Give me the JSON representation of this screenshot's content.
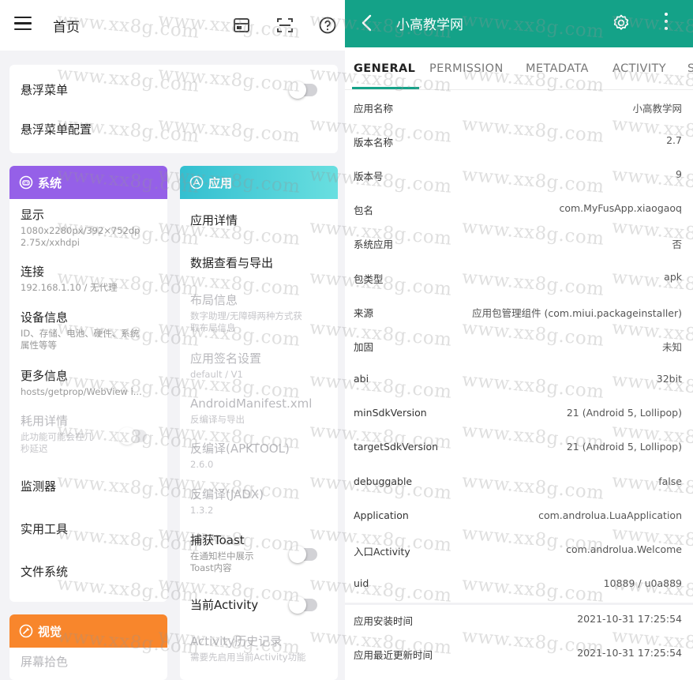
{
  "left": {
    "topbar": {
      "title": "首页",
      "icons": [
        "menu-icon",
        "window-icon",
        "scan-icon",
        "help-icon"
      ]
    },
    "float_card": {
      "items": [
        "悬浮菜单",
        "悬浮菜单配置"
      ]
    },
    "system": {
      "header": "系统",
      "color": "#9560e8",
      "items": [
        {
          "title": "显示",
          "sub": "1080x2280px/392×752dp\n2.75x/xxhdpi"
        },
        {
          "title": "连接",
          "sub": "192.168.1.10 / 无代理"
        },
        {
          "title": "设备信息",
          "sub": "ID、存储、电池、硬件、系统\n属性等等"
        },
        {
          "title": "更多信息",
          "sub": "hosts/getprop/WebView i..."
        },
        {
          "title": "耗用详情",
          "sub": "此功能可能会在几\n秒延迟"
        },
        {
          "title": "监测器",
          "sub": ""
        },
        {
          "title": "实用工具",
          "sub": ""
        },
        {
          "title": "文件系统",
          "sub": ""
        }
      ]
    },
    "apps": {
      "header": "应用",
      "color": "#3fc6cf",
      "items": [
        {
          "title": "应用详情",
          "sub": ""
        },
        {
          "title": "数据查看与导出",
          "sub": ""
        },
        {
          "title": "布局信息",
          "sub": "数字助理/无障碍两种方式获\n取布局信息"
        },
        {
          "title": "应用签名设置",
          "sub": "default / V1"
        },
        {
          "title": "AndroidManifest.xml",
          "sub": "反编译与导出"
        },
        {
          "title": "反编译(APKTOOL)",
          "sub": "2.6.0"
        },
        {
          "title": "反编译(JADX)",
          "sub": "1.3.2"
        },
        {
          "title": "捕获Toast",
          "sub": "在通知栏中展示\nToast内容"
        },
        {
          "title": "当前Activity",
          "sub": ""
        },
        {
          "title": "Activity历史记录",
          "sub": "需要先启用当前Activity功能"
        }
      ]
    },
    "vision": {
      "header": "视觉",
      "color": "#f8862c",
      "items": [
        {
          "title": "屏幕拾色"
        }
      ]
    }
  },
  "right": {
    "appbar": {
      "title": "小高教学网"
    },
    "tabs": [
      "GENERAL",
      "PERMISSION",
      "METADATA",
      "ACTIVITY",
      "S"
    ],
    "active_tab": "GENERAL",
    "rows": [
      {
        "key": "应用名称",
        "value": "小高教学网"
      },
      {
        "key": "版本名称",
        "value": "2.7"
      },
      {
        "key": "版本号",
        "value": "9"
      },
      {
        "key": "包名",
        "value": "com.MyFusApp.xiaogaoq"
      },
      {
        "key": "系统应用",
        "value": "否"
      },
      {
        "key": "包类型",
        "value": "apk"
      },
      {
        "key": "来源",
        "value": "应用包管理组件 (com.miui.packageinstaller)"
      },
      {
        "key": "加固",
        "value": "未知"
      },
      {
        "key": "abi",
        "value": "32bit"
      },
      {
        "key": "minSdkVersion",
        "value": "21 (Android 5, Lollipop)"
      },
      {
        "key": "targetSdkVersion",
        "value": "21 (Android 5, Lollipop)"
      },
      {
        "key": "debuggable",
        "value": "false"
      },
      {
        "key": "Application",
        "value": "com.androlua.LuaApplication"
      },
      {
        "key": "入口Activity",
        "value": "com.androlua.Welcome"
      },
      {
        "key": "uid",
        "value": "10889 / u0a889"
      },
      {
        "key": "应用安装时间",
        "value": "2021-10-31 17:25:54"
      },
      {
        "key": "应用最近更新时间",
        "value": "2021-10-31 17:25:54"
      }
    ],
    "accent": "#14a288"
  },
  "watermark": "www.xx8g.com"
}
